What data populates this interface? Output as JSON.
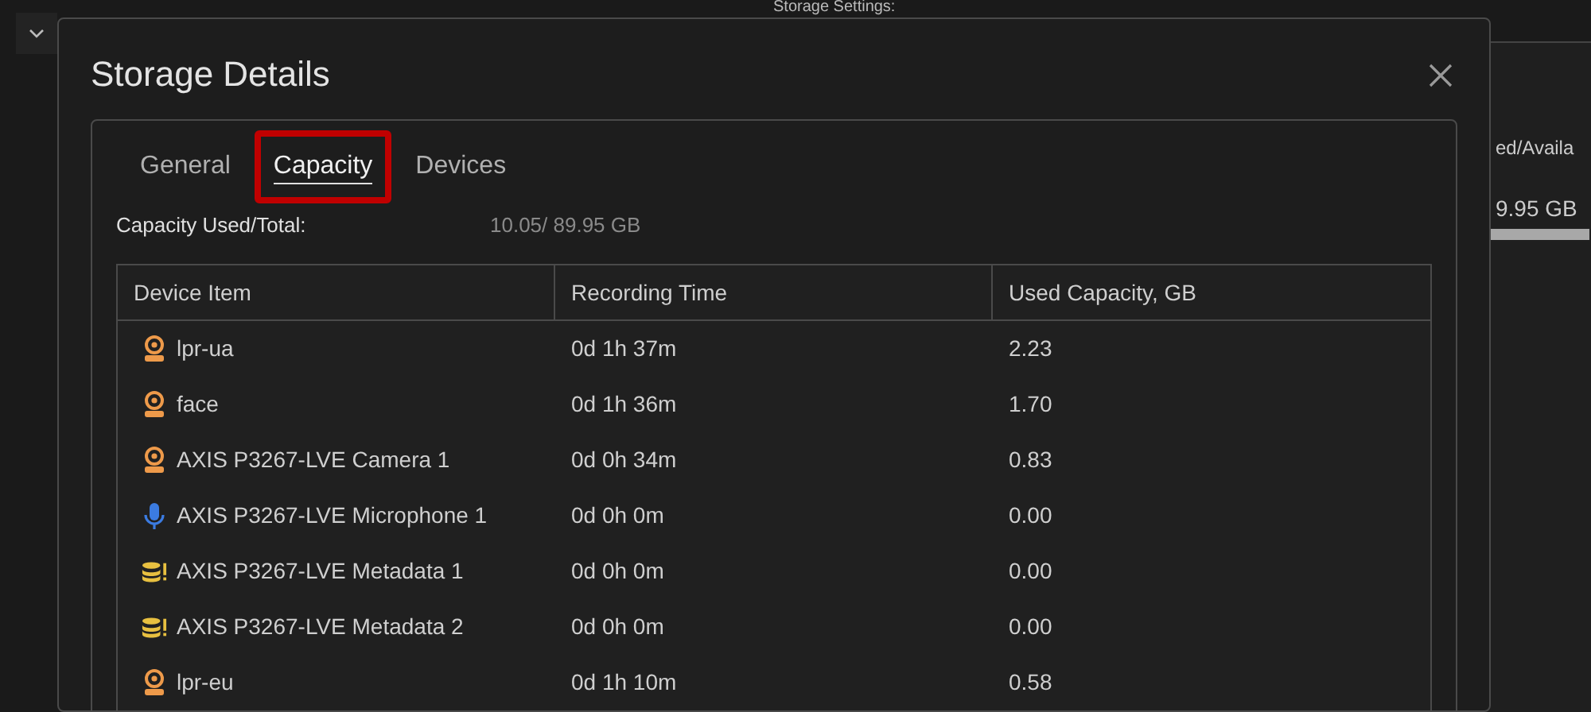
{
  "background": {
    "section_title": "Storage Settings:",
    "column_header": "ed/Availa",
    "usage_value": "9.95 GB"
  },
  "dialog": {
    "title": "Storage Details",
    "tabs": [
      {
        "label": "General",
        "selected": false
      },
      {
        "label": "Capacity",
        "selected": true
      },
      {
        "label": "Devices",
        "selected": false
      }
    ],
    "capacity_label": "Capacity Used/Total:",
    "capacity_value": "10.05/ 89.95 GB",
    "table": {
      "columns": [
        "Device Item",
        "Recording Time",
        "Used Capacity, GB"
      ],
      "rows": [
        {
          "kind": "camera",
          "device": "lpr-ua",
          "time": "0d 1h 37m",
          "used": "2.23"
        },
        {
          "kind": "camera",
          "device": "face",
          "time": "0d 1h 36m",
          "used": "1.70"
        },
        {
          "kind": "camera",
          "device": "AXIS P3267-LVE Camera 1",
          "time": "0d 0h 34m",
          "used": "0.83"
        },
        {
          "kind": "microphone",
          "device": "AXIS P3267-LVE Microphone 1",
          "time": "0d 0h 0m",
          "used": "0.00"
        },
        {
          "kind": "metadata",
          "device": "AXIS P3267-LVE Metadata 1",
          "time": "0d 0h 0m",
          "used": "0.00"
        },
        {
          "kind": "metadata",
          "device": "AXIS P3267-LVE Metadata 2",
          "time": "0d 0h 0m",
          "used": "0.00"
        },
        {
          "kind": "camera",
          "device": "lpr-eu",
          "time": "0d 1h 10m",
          "used": "0.58"
        }
      ]
    }
  }
}
